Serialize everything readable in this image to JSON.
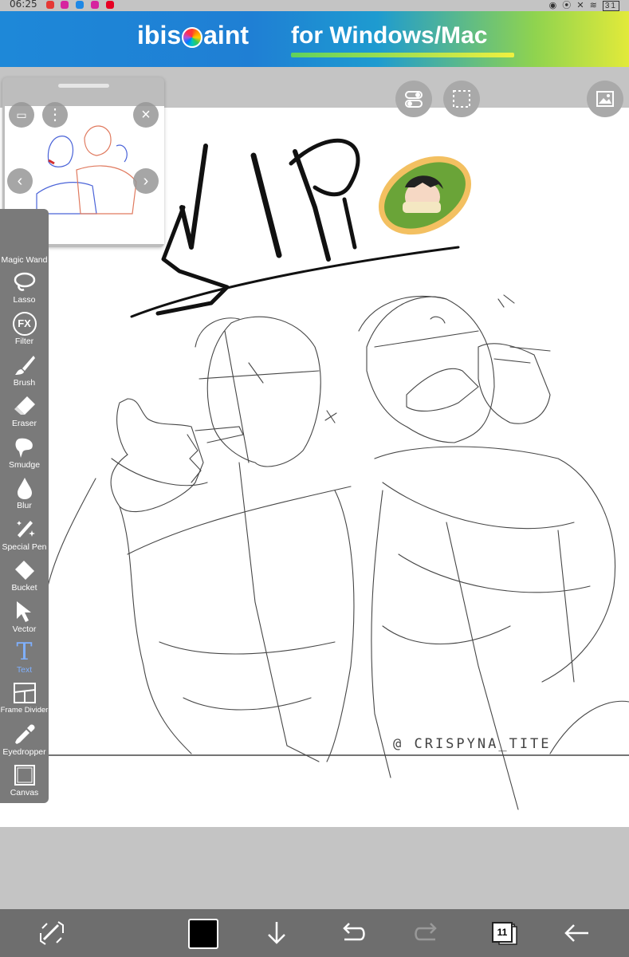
{
  "status": {
    "time": "06:25",
    "battery": "31"
  },
  "banner": {
    "brand_left": "ibis",
    "brand_right": "aint",
    "platform": "for Windows/Mac"
  },
  "artwork": {
    "watermark": "@ CRISPYNA_TITE"
  },
  "tools": [
    {
      "name": "magic-wand",
      "label": "Magic Wand"
    },
    {
      "name": "lasso",
      "label": "Lasso"
    },
    {
      "name": "filter",
      "label": "Filter",
      "icon_text": "FX"
    },
    {
      "name": "brush",
      "label": "Brush"
    },
    {
      "name": "eraser",
      "label": "Eraser"
    },
    {
      "name": "smudge",
      "label": "Smudge"
    },
    {
      "name": "blur",
      "label": "Blur"
    },
    {
      "name": "special-pen",
      "label": "Special Pen"
    },
    {
      "name": "bucket",
      "label": "Bucket"
    },
    {
      "name": "vector",
      "label": "Vector"
    },
    {
      "name": "text",
      "label": "Text",
      "icon_text": "T"
    },
    {
      "name": "frame-divider",
      "label": "Frame Divider"
    },
    {
      "name": "eyedropper",
      "label": "Eyedropper"
    },
    {
      "name": "canvas",
      "label": "Canvas"
    }
  ],
  "active_tool": "text",
  "layers": {
    "count": "11"
  },
  "colors": {
    "toolbar_bg": "#7a7a7a",
    "active_tool_label": "#7fb0ff",
    "current_color": "#000000"
  }
}
